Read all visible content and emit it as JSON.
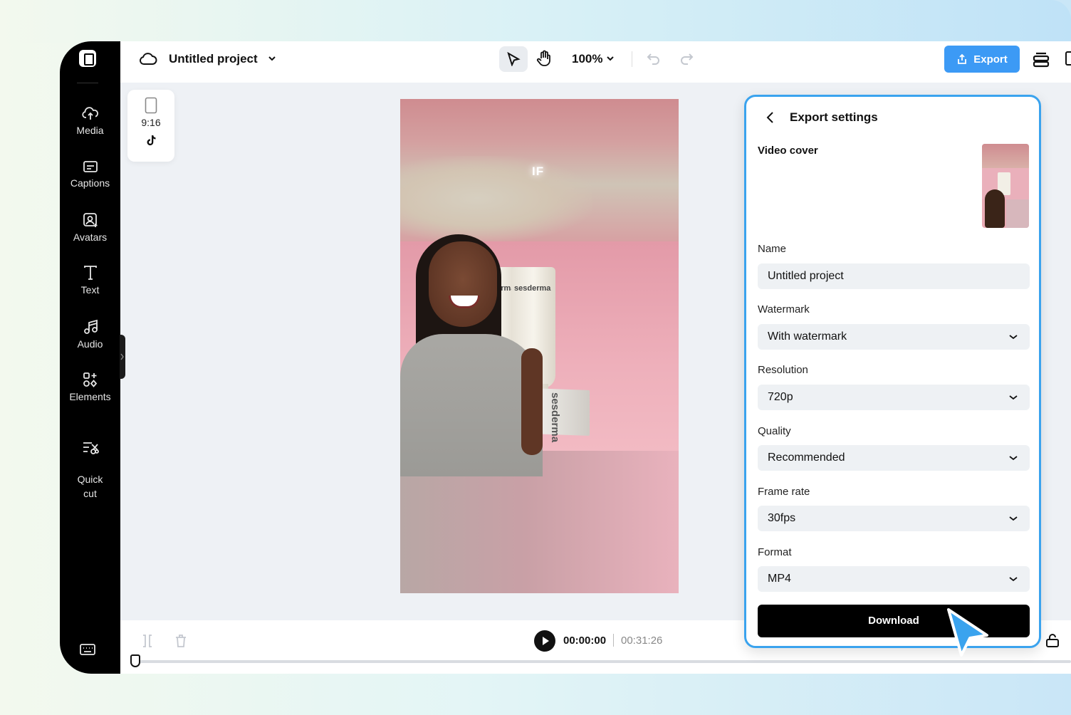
{
  "sidebar": {
    "items": [
      {
        "label": "Media",
        "icon": "cloud-upload-icon"
      },
      {
        "label": "Captions",
        "icon": "captions-icon"
      },
      {
        "label": "Avatars",
        "icon": "avatar-icon"
      },
      {
        "label": "Text",
        "icon": "text-icon"
      },
      {
        "label": "Audio",
        "icon": "music-note-icon"
      },
      {
        "label": "Elements",
        "icon": "elements-icon"
      },
      {
        "label": "Quick\ncut",
        "icon": "quick-cut-icon"
      }
    ]
  },
  "header": {
    "project_title": "Untitled project",
    "zoom": "100%",
    "export_label": "Export"
  },
  "canvas": {
    "aspect_ratio": "9:16",
    "video_overlay_text": "IF",
    "product_brand": "sesderma"
  },
  "timeline": {
    "current_time": "00:00:00",
    "total_time": "00:31:26"
  },
  "export_panel": {
    "title": "Export settings",
    "video_cover_label": "Video cover",
    "name_label": "Name",
    "name_value": "Untitled project",
    "watermark_label": "Watermark",
    "watermark_value": "With watermark",
    "resolution_label": "Resolution",
    "resolution_value": "720p",
    "quality_label": "Quality",
    "quality_value": "Recommended",
    "framerate_label": "Frame rate",
    "framerate_value": "30fps",
    "format_label": "Format",
    "format_value": "MP4",
    "download_label": "Download"
  },
  "colors": {
    "accent": "#3c9af5",
    "popover_border": "#3aa3ee",
    "sidebar_bg": "#000000"
  }
}
